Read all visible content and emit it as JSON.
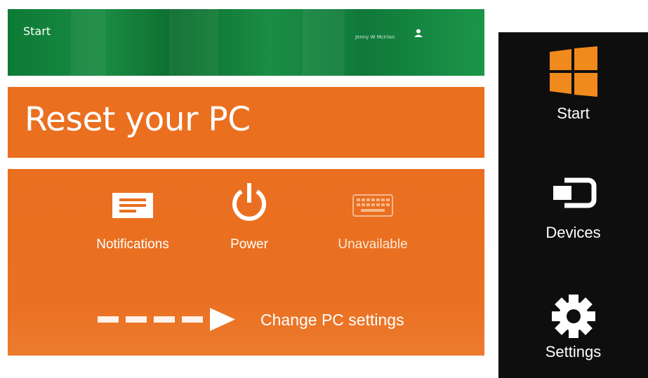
{
  "start_strip": {
    "label": "Start",
    "user_name": "Jenny W McIrion",
    "user_icon": "person-icon"
  },
  "reset_header": {
    "title": "Reset your PC"
  },
  "quick_settings": [
    {
      "label": "Notifications",
      "icon": "notifications-icon"
    },
    {
      "label": "Power",
      "icon": "power-icon"
    },
    {
      "label": "Unavailable",
      "icon": "keyboard-icon"
    }
  ],
  "change_settings": {
    "label": "Change PC settings",
    "icon": "dashed-arrow-icon"
  },
  "charms": [
    {
      "label": "Start",
      "icon": "windows-logo-icon"
    },
    {
      "label": "Devices",
      "icon": "devices-icon"
    },
    {
      "label": "Settings",
      "icon": "gear-icon"
    }
  ],
  "colors": {
    "accent_orange": "#ea6f1f",
    "start_green": "#12803b",
    "charms_bg": "#0e0e0e",
    "windows_logo": "#f08a1c"
  }
}
